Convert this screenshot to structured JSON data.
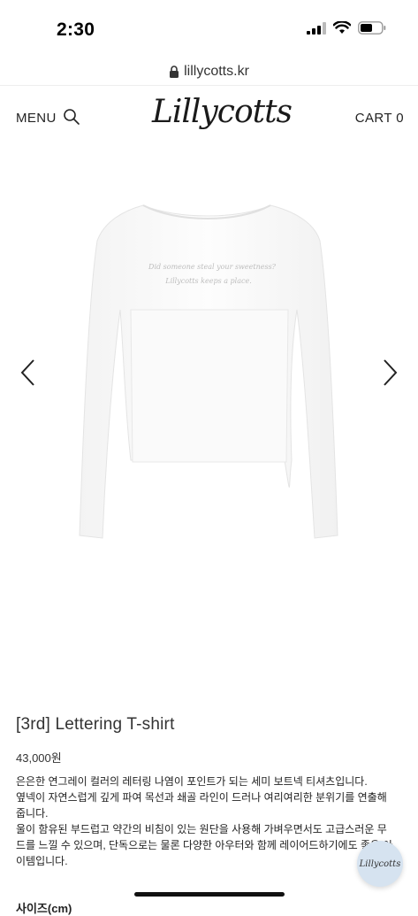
{
  "status": {
    "time": "2:30"
  },
  "browser": {
    "url": "lillycotts.kr"
  },
  "header": {
    "menu_label": "MENU",
    "logo_text": "Lillycotts",
    "cart_label": "CART 0"
  },
  "product": {
    "shirt_print_line1": "Did someone steal your sweetness?",
    "shirt_print_line2": "Lillycotts keeps a place.",
    "title": "[3rd] Lettering T-shirt",
    "price": "43,000원",
    "description": [
      "은은한 연그레이 컬러의 레터링 나염이 포인트가 되는 세미 보트넥 티셔츠입니다.",
      "옆넥이 자연스럽게 깊게 파여 목선과 쇄골 라인이 드러나 여리여리한 분위기를 연출해 줍니다.",
      "울이 함유된 부드럽고 약간의 비침이 있는 원단을 사용해 가벼우면서도 고급스러운 무드를 느낄 수 있으며, 단독으로는 물론 다양한 아우터와 함께 레이어드하기에도 좋은 아이템입니다."
    ],
    "next_section_peek": "사이즈(cm)"
  },
  "floating_button": {
    "label": "Lillycotts"
  },
  "colors": {
    "background": "#ffffff",
    "text": "#222222",
    "floating_bg": "#d6e3f0"
  }
}
